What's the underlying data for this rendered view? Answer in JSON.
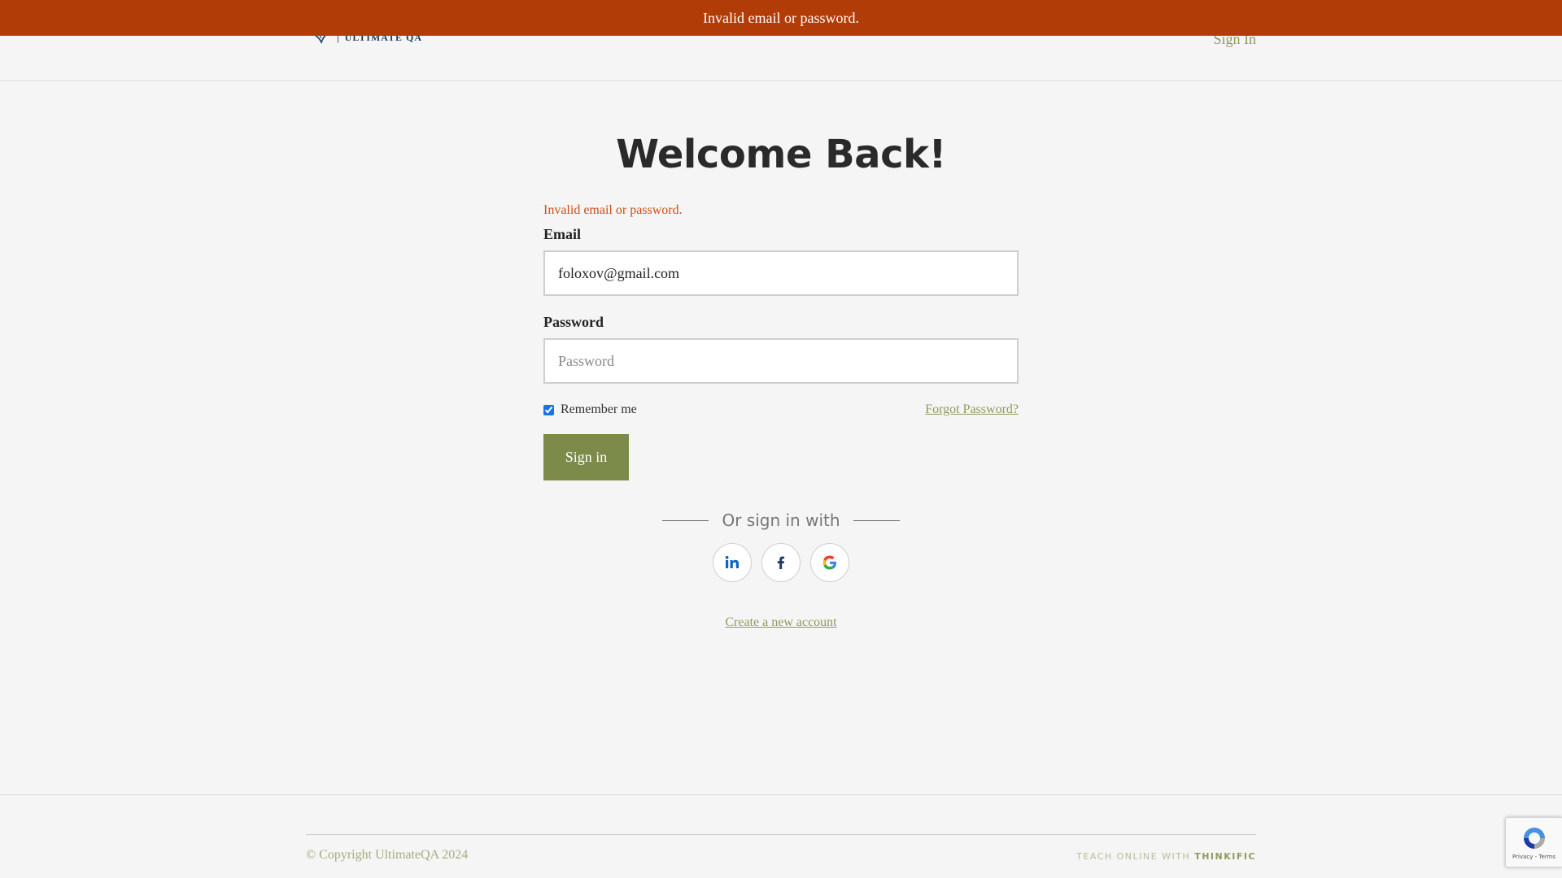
{
  "alert": {
    "text": "Invalid email or password."
  },
  "header": {
    "logo_text": "ULTIMATE QA",
    "signin_link": "Sign In"
  },
  "page": {
    "title": "Welcome Back!"
  },
  "form": {
    "error": "Invalid email or password.",
    "email_label": "Email",
    "email_value": "foloxov@gmail.com",
    "password_label": "Password",
    "password_placeholder": "Password",
    "remember_label": "Remember me",
    "remember_checked": true,
    "forgot_link": "Forgot Password?",
    "submit_label": "Sign in"
  },
  "social": {
    "heading": "Or sign in with",
    "providers": [
      "linkedin-icon",
      "facebook-icon",
      "google-icon"
    ]
  },
  "create_account": "Create a new account",
  "footer": {
    "copyright": "© Copyright UltimateQA 2024",
    "teach_prefix": "TEACH ONLINE WITH",
    "teach_brand": "THINKIFIC"
  },
  "recaptcha": {
    "links": "Privacy - Terms"
  },
  "colors": {
    "alert_bg": "#b23c07",
    "accent": "#7c8b4a",
    "link": "#8f9a5c",
    "error": "#d24d13"
  }
}
